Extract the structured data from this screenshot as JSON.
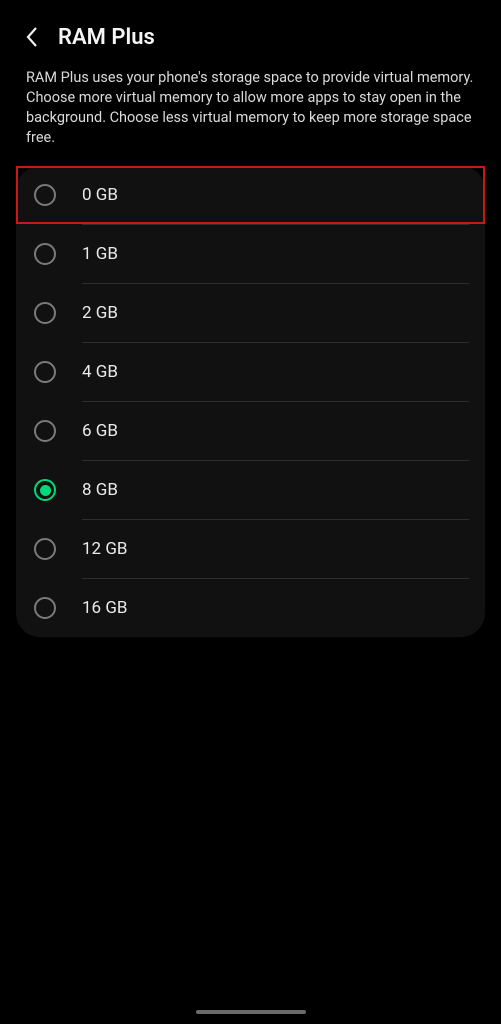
{
  "header": {
    "title": "RAM Plus"
  },
  "description": "RAM Plus uses your phone's storage space to provide virtual memory. Choose more virtual memory to allow more apps to stay open in the background. Choose less virtual memory to keep more storage space free.",
  "options": [
    {
      "label": "0 GB",
      "selected": false,
      "highlighted": true
    },
    {
      "label": "1 GB",
      "selected": false,
      "highlighted": false
    },
    {
      "label": "2 GB",
      "selected": false,
      "highlighted": false
    },
    {
      "label": "4 GB",
      "selected": false,
      "highlighted": false
    },
    {
      "label": "6 GB",
      "selected": false,
      "highlighted": false
    },
    {
      "label": "8 GB",
      "selected": true,
      "highlighted": false
    },
    {
      "label": "12 GB",
      "selected": false,
      "highlighted": false
    },
    {
      "label": "16 GB",
      "selected": false,
      "highlighted": false
    }
  ]
}
